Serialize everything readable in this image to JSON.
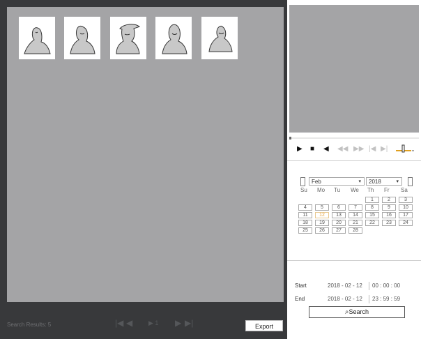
{
  "results": {
    "thumbnails": [
      {
        "icon": "face-capture-icon"
      },
      {
        "icon": "face-capture-icon"
      },
      {
        "icon": "face-capture-icon"
      },
      {
        "icon": "face-capture-icon"
      },
      {
        "icon": "face-capture-icon"
      }
    ]
  },
  "bottom_bar": {
    "result_label": "Search Results: 5",
    "page": "1",
    "export_label": "Export"
  },
  "player": {
    "controls": [
      "play-icon",
      "stop-icon",
      "prev-frame-icon",
      "slow-icon",
      "fast-icon",
      "previous-icon",
      "next-icon",
      "volume-icon"
    ]
  },
  "calendar": {
    "month": "Feb",
    "year": "2018",
    "weekdays": [
      "Su",
      "Mo",
      "Tu",
      "We",
      "Th",
      "Fr",
      "Sa"
    ],
    "days": [
      "1",
      "2",
      "3",
      "4",
      "5",
      "6",
      "7",
      "8",
      "9",
      "10",
      "11",
      "12",
      "13",
      "14",
      "15",
      "16",
      "17",
      "18",
      "19",
      "20",
      "21",
      "22",
      "23",
      "24",
      "25",
      "26",
      "27",
      "28"
    ],
    "highlight_day": "12",
    "first_weekday": 4
  },
  "filter": {
    "start_label": "Start",
    "start_date": "2018 - 02 - 12",
    "start_time": "00 : 00 : 00",
    "end_label": "End",
    "end_date": "2018 - 02 - 12",
    "end_time": "23 : 59 : 59",
    "search_label": "Search"
  }
}
